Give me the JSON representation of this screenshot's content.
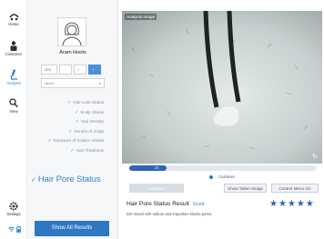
{
  "nav": {
    "items": [
      {
        "label": "Home",
        "icon": "home-icon"
      },
      {
        "label": "Customer",
        "icon": "person-icon"
      },
      {
        "label": "Analysis",
        "icon": "microscope-icon",
        "active": true
      },
      {
        "label": "View",
        "icon": "magnifier-icon"
      }
    ],
    "settings_label": "Settings"
  },
  "side": {
    "customer_name": "Aram Hoots",
    "chips": [
      "20's",
      "",
      "♂",
      "♀"
    ],
    "select_value": "Never",
    "checklist": [
      "Hair Loss Status",
      "Scalp Status",
      "Hair Density",
      "Keratin of Scalp",
      "Exposure of Scalp's Vessel",
      "Hair Thickness"
    ],
    "current_status": "Hair Pore Status",
    "show_all_label": "Show All Results"
  },
  "image": {
    "tag": "Analysis Image"
  },
  "progress": {
    "value": 20,
    "max": 100,
    "label": "20"
  },
  "customer_radio_label": "Customer",
  "buttons": {
    "analysis": "Analysis",
    "show_taken": "Show Taken Image",
    "control_menu": "Control Menu On"
  },
  "result": {
    "title": "Hair Pore Status Result",
    "grade": "Good",
    "stars": 5,
    "description": "Dirt mixed with sebum and impurities blocks pores."
  },
  "colors": {
    "accent": "#2f76c3",
    "progress": "#2f64b6",
    "star": "#2f64b6"
  }
}
